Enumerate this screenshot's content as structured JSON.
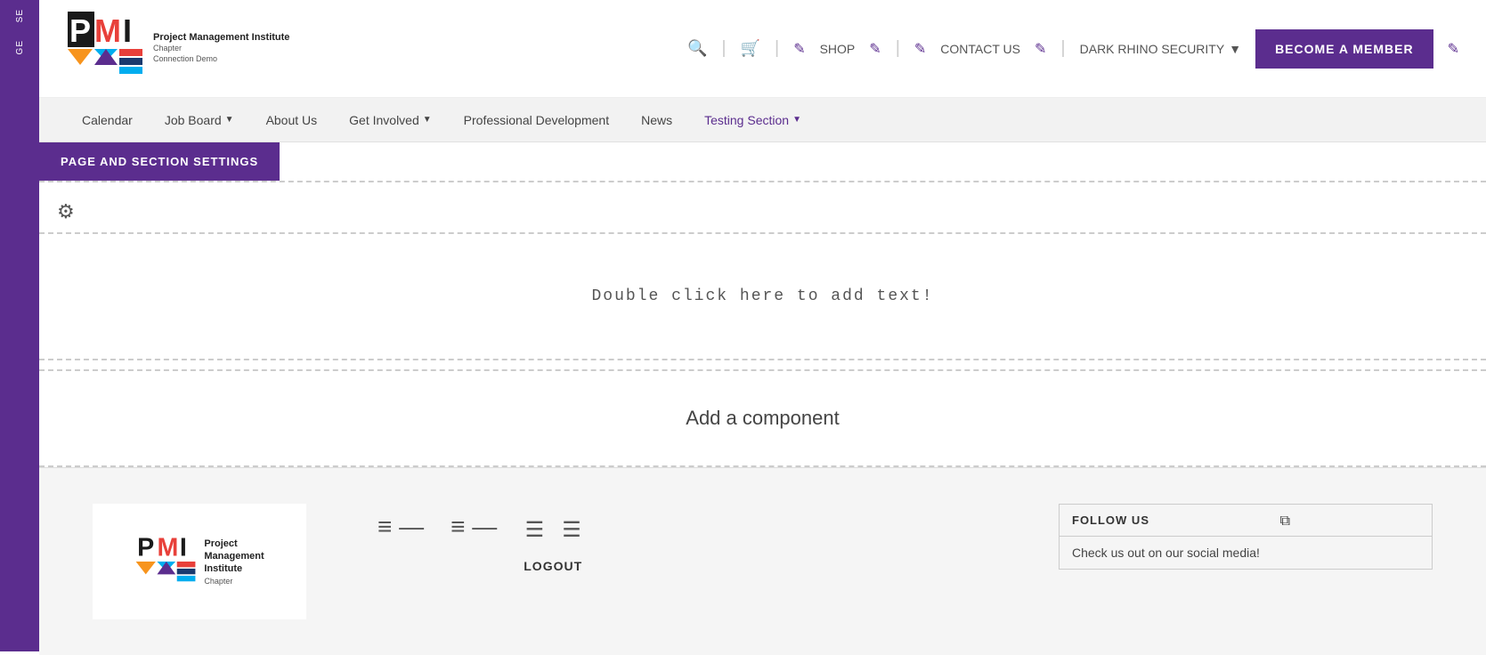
{
  "sidebar": {
    "items": [
      {
        "label": "SE",
        "id": "sidebar-se"
      },
      {
        "label": "GE",
        "id": "sidebar-ge"
      }
    ]
  },
  "header": {
    "logo_title": "Project Management Institute",
    "logo_subtitle": "Chapter\nConnection Demo",
    "shop_label": "SHOP",
    "contact_us_label": "CONTACT US",
    "dark_rhino_label": "DARK RHINO SECURITY",
    "become_member_label": "BECOME A MEMBER",
    "pencil_symbol": "✎"
  },
  "navbar": {
    "items": [
      {
        "label": "Calendar",
        "has_dropdown": false,
        "id": "nav-calendar"
      },
      {
        "label": "Job Board",
        "has_dropdown": true,
        "id": "nav-job-board"
      },
      {
        "label": "About Us",
        "has_dropdown": false,
        "id": "nav-about-us"
      },
      {
        "label": "Get Involved",
        "has_dropdown": true,
        "id": "nav-get-involved"
      },
      {
        "label": "Professional Development",
        "has_dropdown": false,
        "id": "nav-pro-dev"
      },
      {
        "label": "News",
        "has_dropdown": false,
        "id": "nav-news"
      },
      {
        "label": "Testing Section",
        "has_dropdown": true,
        "id": "nav-testing",
        "purple": true
      }
    ]
  },
  "page_settings": {
    "label": "PAGE AND SECTION SETTINGS"
  },
  "content": {
    "placeholder_text": "Double click here to add text!",
    "add_component_text": "Add a component"
  },
  "footer": {
    "logo_title": "Project Management Institute",
    "logo_subtitle": "Chapter",
    "follow_us_title": "FOLLOW US",
    "follow_us_text": "Check us out on our social media!",
    "logout_label": "LOGOUT"
  }
}
